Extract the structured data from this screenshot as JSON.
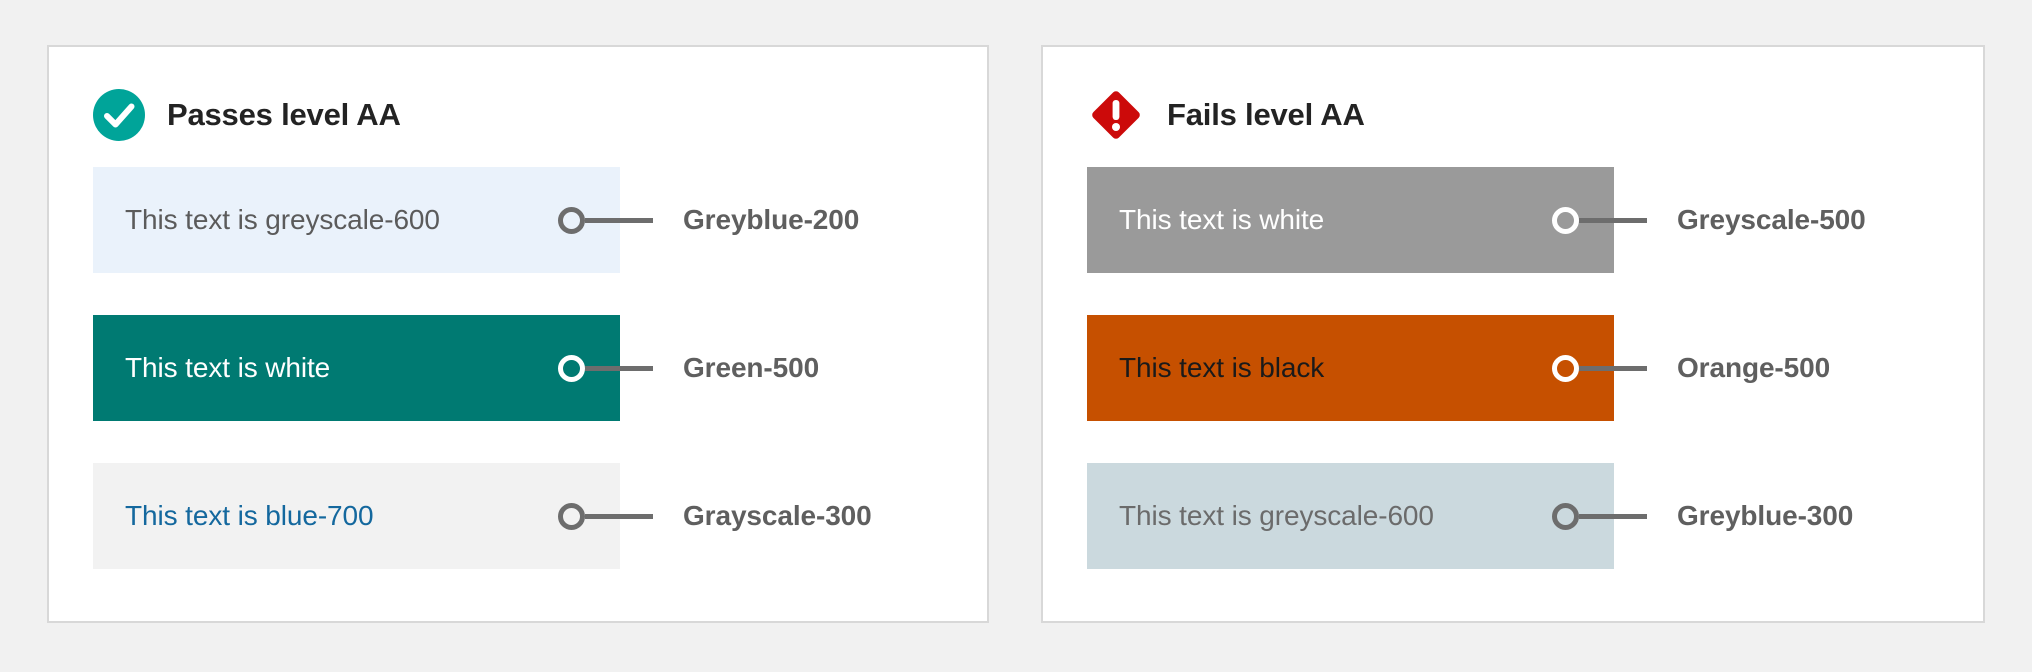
{
  "page": {
    "background_color": "#f1f1f1"
  },
  "panels": [
    {
      "id": "passes",
      "title": "Passes level AA",
      "icon": "check-circle-icon",
      "icon_color": "#00a499",
      "rows": [
        {
          "sample_text": "This text is greyscale-600",
          "label": "Greyblue-200",
          "swatch_color": "#eaf2fb",
          "text_color": "#5b5b5b",
          "dot_on_dark": false
        },
        {
          "sample_text": "This text is white",
          "label": "Green-500",
          "swatch_color": "#007a72",
          "text_color": "#ffffff",
          "dot_on_dark": true
        },
        {
          "sample_text": "This text is blue-700",
          "label": "Grayscale-300",
          "swatch_color": "#f2f2f2",
          "text_color": "#14689e",
          "dot_on_dark": false
        }
      ]
    },
    {
      "id": "fails",
      "title": "Fails level AA",
      "icon": "alert-diamond-icon",
      "icon_color": "#cc0a0a",
      "rows": [
        {
          "sample_text": "This text is white",
          "label": "Greyscale-500",
          "swatch_color": "#9a9a9a",
          "text_color": "#ffffff",
          "dot_on_dark": true
        },
        {
          "sample_text": "This text is black",
          "label": "Orange-500",
          "swatch_color": "#c65000",
          "text_color": "#1a1a1a",
          "dot_on_dark": true
        },
        {
          "sample_text": "This text is greyscale-600",
          "label": "Greyblue-300",
          "swatch_color": "#cbd9de",
          "text_color": "#6b6b6b",
          "dot_on_dark": false
        }
      ]
    }
  ]
}
